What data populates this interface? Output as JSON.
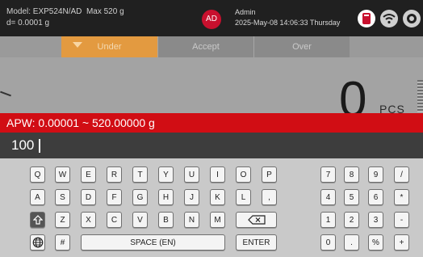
{
  "status_bar": {
    "model": "Model: EXP524N/AD",
    "max": "Max 520 g",
    "resolution": "d= 0.0001 g",
    "avatar_initials": "AD",
    "user": "Admin",
    "datetime": "2025-May-08 14:06:33 Thursday",
    "icons": [
      "usb-icon",
      "wifi-icon",
      "settings-icon"
    ]
  },
  "tolerance_tabs": [
    {
      "label": "Under",
      "color": "#e39a40",
      "selected": true
    },
    {
      "label": "Accept"
    },
    {
      "label": "Over"
    }
  ],
  "weight": {
    "value": "0",
    "unit": "PCS"
  },
  "dialog": {
    "header": "APW: 0.00001 ~ 520.00000 g",
    "input_value": "100"
  },
  "keyboard": {
    "row1": [
      "Q",
      "W",
      "E",
      "R",
      "T",
      "Y",
      "U",
      "I",
      "O",
      "P"
    ],
    "row2": [
      "A",
      "S",
      "D",
      "F",
      "G",
      "H",
      "J",
      "K",
      "L",
      ","
    ],
    "row3": [
      "Z",
      "X",
      "C",
      "V",
      "B",
      "N",
      "M"
    ],
    "row4_hash": "#",
    "space_label": "SPACE (EN)",
    "enter_label": "ENTER",
    "numpad": [
      [
        "7",
        "8",
        "9",
        "/"
      ],
      [
        "4",
        "5",
        "6",
        "*"
      ],
      [
        "1",
        "2",
        "3",
        "-"
      ],
      [
        "0",
        ".",
        "%",
        "+"
      ]
    ]
  },
  "colors": {
    "accent_red": "#d10d14",
    "under_orange": "#e39a40",
    "status_bar": "#202020"
  }
}
